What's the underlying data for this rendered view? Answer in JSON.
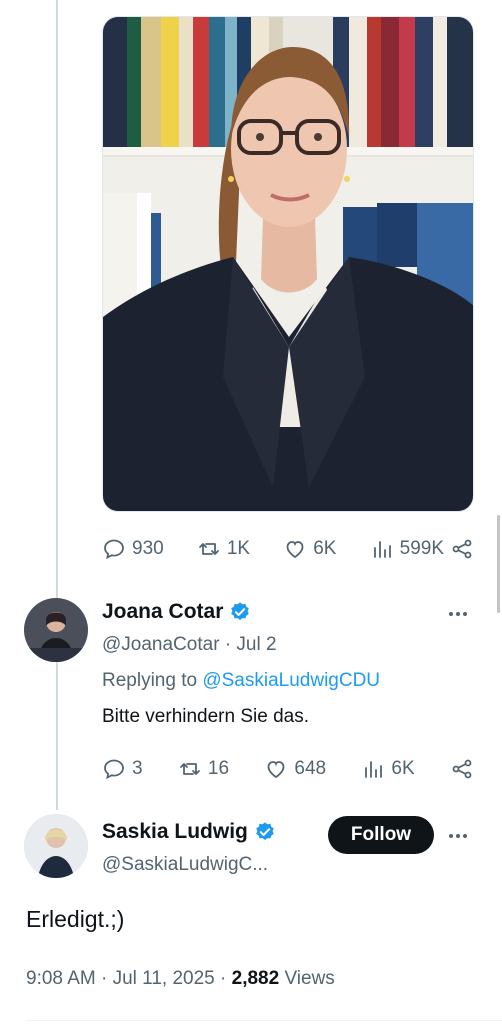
{
  "media": {
    "description_icon": "photo-portrait"
  },
  "quoted_stats": {
    "replies": "930",
    "reposts": "1K",
    "likes": "6K",
    "views": "599K"
  },
  "reply": {
    "name": "Joana Cotar",
    "handle": "@JoanaCotar",
    "date": "Jul 2",
    "replying_prefix": "Replying to",
    "replying_to": "@SaskiaLudwigCDU",
    "text": "Bitte verhindern Sie das.",
    "stats": {
      "replies": "3",
      "reposts": "16",
      "likes": "648",
      "views": "6K"
    }
  },
  "main_tweet": {
    "name": "Saskia Ludwig",
    "handle": "@SaskiaLudwigC...",
    "follow_label": "Follow",
    "text": "Erledigt.;)",
    "time": "9:08 AM",
    "date": "Jul 11, 2025",
    "views_count": "2,882",
    "views_label": "Views"
  },
  "colors": {
    "accent": "#1d9bf0",
    "text": "#0f1419",
    "muted": "#536471"
  }
}
